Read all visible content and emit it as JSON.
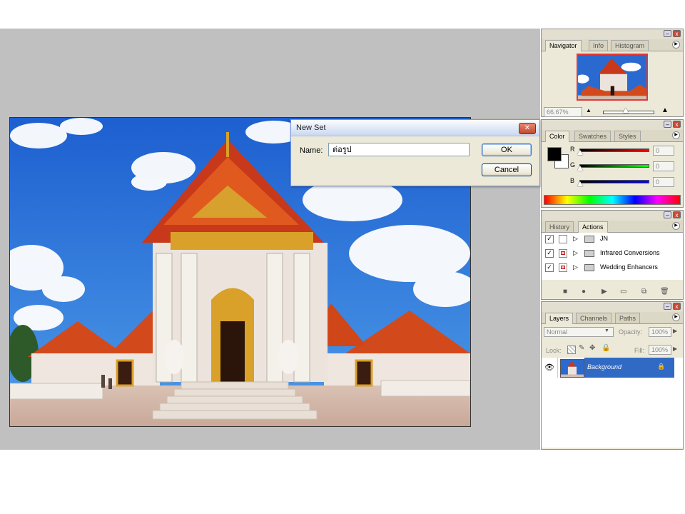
{
  "colors": {
    "workspace": "#c0c0c0",
    "palette_bg": "#ece9d8",
    "selection": "#316ac5"
  },
  "dialog": {
    "title": "New Set",
    "name_label": "Name:",
    "name_value": "ต่อรูป",
    "ok_label": "OK",
    "cancel_label": "Cancel"
  },
  "navigator": {
    "tabs": [
      "Navigator",
      "Info",
      "Histogram"
    ],
    "zoom": "66.67%"
  },
  "color_panel": {
    "tabs": [
      "Color",
      "Swatches",
      "Styles"
    ],
    "channels": [
      {
        "label": "R",
        "value": "0"
      },
      {
        "label": "G",
        "value": "0"
      },
      {
        "label": "B",
        "value": "0"
      }
    ]
  },
  "actions_panel": {
    "tabs": [
      "History",
      "Actions"
    ],
    "items": [
      {
        "label": "JN",
        "checked": true,
        "dialog": false
      },
      {
        "label": "Infrared Conversions",
        "checked": true,
        "dialog": true
      },
      {
        "label": "Wedding Enhancers",
        "checked": true,
        "dialog": true
      }
    ],
    "toolbar_icons": [
      "stop-icon",
      "record-icon",
      "play-icon",
      "new-set-icon",
      "new-action-icon",
      "delete-icon"
    ]
  },
  "layers_panel": {
    "tabs": [
      "Layers",
      "Channels",
      "Paths"
    ],
    "blend_mode": "Normal",
    "opacity_label": "Opacity:",
    "opacity_value": "100%",
    "lock_label": "Lock:",
    "fill_label": "Fill:",
    "fill_value": "100%",
    "layers": [
      {
        "name": "Background",
        "visible": true,
        "locked": true,
        "selected": true
      }
    ]
  }
}
